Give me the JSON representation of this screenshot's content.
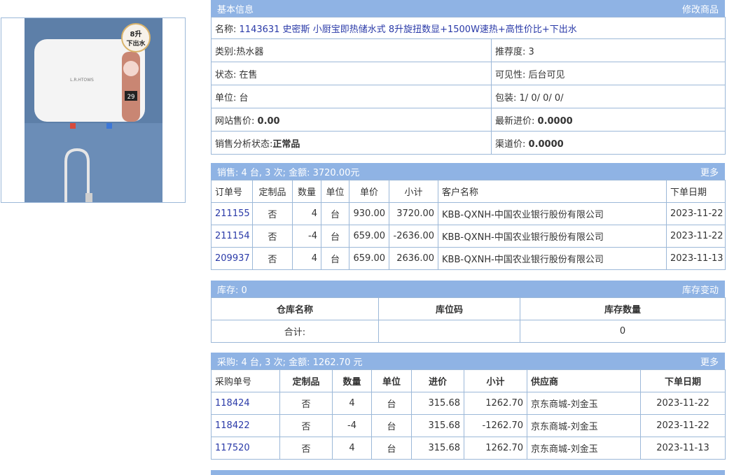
{
  "product_image": {
    "badge_top": "8升",
    "badge_bottom": "下出水",
    "brand": "L.R.HTOWS",
    "display": "29"
  },
  "basic": {
    "title": "基本信息",
    "edit_link": "修改商品",
    "name_label": "名称:",
    "name_value": "1143631 史密斯 小厨宝即热储水式 8升旋扭数显+1500W速热+高性价比+下出水",
    "category_label": "类别:",
    "category_value": "热水器",
    "recommend_label": "推荐度:",
    "recommend_value": "3",
    "status_label": "状态:",
    "status_value": "在售",
    "visibility_label": "可见性:",
    "visibility_value": "后台可见",
    "unit_label": "单位:",
    "unit_value": "台",
    "pack_label": "包装:",
    "pack_value": "1/ 0/ 0/ 0/",
    "web_price_label": "网站售价:",
    "web_price_value": "0.00",
    "latest_cost_label": "最新进价:",
    "latest_cost_value": "0.0000",
    "sales_status_label": "销售分析状态:",
    "sales_status_value": "正常品",
    "channel_price_label": "渠道价:",
    "channel_price_value": "0.0000"
  },
  "sales": {
    "title": "销售:  4 台, 3 次; 金额: 3720.00元",
    "more": "更多",
    "headers": [
      "订单号",
      "定制品",
      "数量",
      "单位",
      "单价",
      "小计",
      "客户名称",
      "下单日期"
    ],
    "rows": [
      [
        "211155",
        "否",
        "4",
        "台",
        "930.00",
        "3720.00",
        "KBB-QXNH-中国农业银行股份有限公司",
        "2023-11-22"
      ],
      [
        "211154",
        "否",
        "-4",
        "台",
        "659.00",
        "-2636.00",
        "KBB-QXNH-中国农业银行股份有限公司",
        "2023-11-22"
      ],
      [
        "209937",
        "否",
        "4",
        "台",
        "659.00",
        "2636.00",
        "KBB-QXNH-中国农业银行股份有限公司",
        "2023-11-13"
      ]
    ]
  },
  "stock": {
    "title": "库存:  0",
    "change_link": "库存变动",
    "headers": [
      "仓库名称",
      "库位码",
      "库存数量"
    ],
    "total_label": "合计:",
    "total_location": "",
    "total_qty": "0"
  },
  "purchase": {
    "title": "采购:  4 台, 3 次; 金额: 1262.70 元",
    "more": "更多",
    "headers": [
      "采购单号",
      "定制品",
      "数量",
      "单位",
      "进价",
      "小计",
      "供应商",
      "下单日期"
    ],
    "rows": [
      [
        "118424",
        "否",
        "4",
        "台",
        "315.68",
        "1262.70",
        "京东商城-刘金玉",
        "2023-11-22"
      ],
      [
        "118422",
        "否",
        "-4",
        "台",
        "315.68",
        "-1262.70",
        "京东商城-刘金玉",
        "2023-11-22"
      ],
      [
        "117520",
        "否",
        "4",
        "台",
        "315.68",
        "1262.70",
        "京东商城-刘金玉",
        "2023-11-13"
      ]
    ]
  }
}
